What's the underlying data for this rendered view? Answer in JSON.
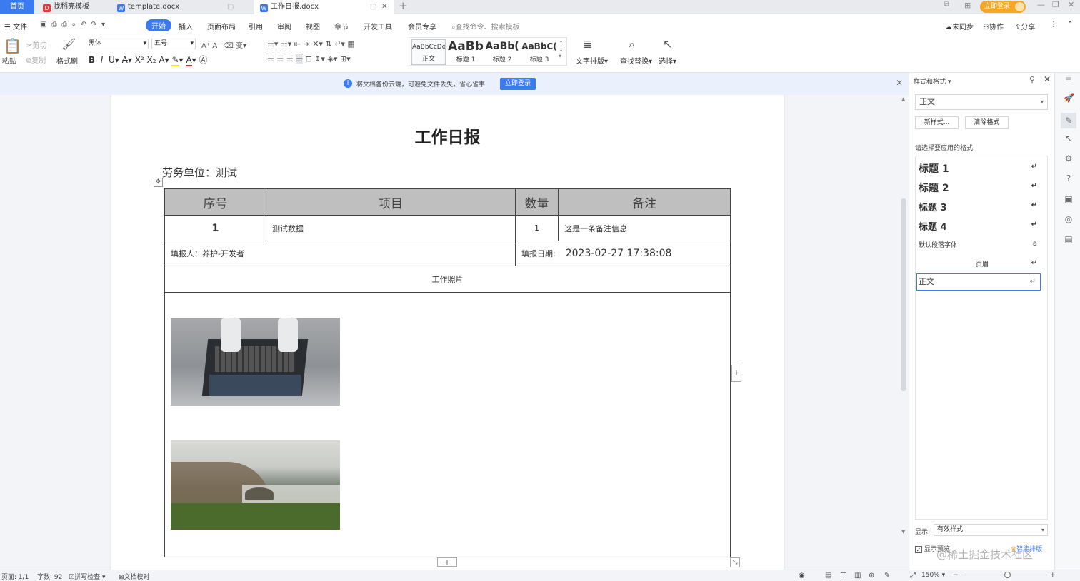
{
  "tabs": {
    "home": "首页",
    "t1": "找稻壳模板",
    "t2": "template.docx",
    "t3": "工作日报.docx",
    "login": "立即登录"
  },
  "menu": {
    "file": "文件",
    "items": [
      "开始",
      "插入",
      "页面布局",
      "引用",
      "审阅",
      "视图",
      "章节",
      "开发工具",
      "会员专享"
    ],
    "search_placeholder": "查找命令、搜索模板",
    "sync": "未同步",
    "collab": "协作",
    "share": "分享"
  },
  "ribbon": {
    "paste": "粘贴",
    "cut": "剪切",
    "copy": "复制",
    "format_painter": "格式刷",
    "font": "黑体",
    "size": "五号",
    "styles": [
      {
        "preview": "AaBbCcDd",
        "label": "正文"
      },
      {
        "preview": "AaBb",
        "label": "标题 1"
      },
      {
        "preview": "AaBb(",
        "label": "标题 2"
      },
      {
        "preview": "AaBbC(",
        "label": "标题 3"
      }
    ],
    "layout": "文字排版",
    "find": "查找替换",
    "select": "选择"
  },
  "notice": {
    "text": "将文档备份云端，可避免文件丢失，省心省事",
    "button": "立即登录"
  },
  "doc": {
    "title": "工作日报",
    "unit": "劳务单位：测试",
    "headers": [
      "序号",
      "项目",
      "数量",
      "备注"
    ],
    "row": {
      "no": "1",
      "item": "测试数据",
      "qty": "1",
      "remark": "这是一条备注信息"
    },
    "filler": "填报人：养护-开发者",
    "date_label": "填报日期:",
    "date_value": "2023-02-27 17:38:08",
    "photos_label": "工作照片"
  },
  "panel": {
    "title": "样式和格式",
    "current": "正文",
    "new_style": "新样式...",
    "clear": "清除格式",
    "prompt": "请选择要应用的格式",
    "styles": [
      "标题 1",
      "标题 2",
      "标题 3",
      "标题 4",
      "默认段落字体",
      "页眉",
      "正文"
    ],
    "show_label": "显示:",
    "show_value": "有效样式",
    "preview": "显示预览",
    "smart": "智能排版"
  },
  "status": {
    "page": "页面: 1/1",
    "words": "字数: 92",
    "spell": "拼写检查",
    "proof": "文档校对",
    "zoom": "150%"
  },
  "watermark": "@稀土掘金技术社区",
  "colors": {
    "accent": "#3c7bef",
    "header_fill": "#bfbfbf"
  }
}
